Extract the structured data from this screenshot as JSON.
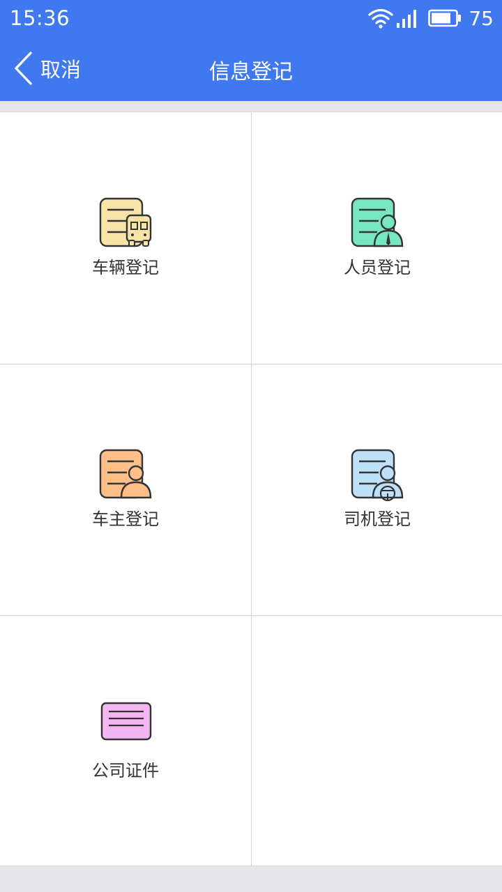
{
  "status_bar": {
    "time": "15:36",
    "battery_level": "75",
    "icons": [
      "wifi-icon",
      "signal-icon",
      "battery-icon"
    ]
  },
  "nav": {
    "back_label": "取消",
    "title": "信息登记"
  },
  "colors": {
    "header_bg": "#4079ef",
    "page_bg": "#e6e5e7",
    "vehicle_icon": "#f6e5a6",
    "person_icon": "#77e7c1",
    "owner_icon": "#fdbe88",
    "driver_icon": "#bfe0f9",
    "company_icon": "#f4b6f3"
  },
  "grid": {
    "items": [
      {
        "label": "车辆登记",
        "icon": "vehicle-registration-icon"
      },
      {
        "label": "人员登记",
        "icon": "personnel-registration-icon"
      },
      {
        "label": "车主登记",
        "icon": "owner-registration-icon"
      },
      {
        "label": "司机登记",
        "icon": "driver-registration-icon"
      },
      {
        "label": "公司证件",
        "icon": "company-certificate-icon"
      }
    ]
  }
}
